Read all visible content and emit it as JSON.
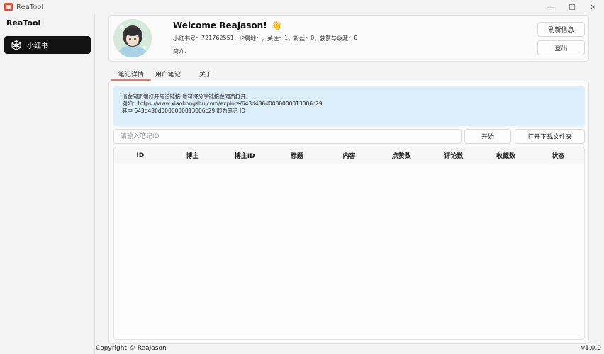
{
  "window": {
    "title": "ReaTool",
    "controls": {
      "minimize": "—",
      "maximize": "☐",
      "close": "✕"
    }
  },
  "sidebar": {
    "title": "ReaTool",
    "items": [
      {
        "label": "小红书",
        "icon": "xiaohongshu-icon",
        "active": true
      }
    ]
  },
  "profile": {
    "welcome": "Welcome ReaJason!",
    "wave": "👋",
    "id_label": "小红书号：",
    "id_value": "721762551",
    "ip_label": "，IP属地：",
    "ip_value": "",
    "follow_label": "，关注：",
    "follow_value": "1",
    "fans_label": "，粉丝：",
    "fans_value": "0",
    "likes_label": "，获赞与收藏：",
    "likes_value": "0",
    "bio_label": "简介：",
    "bio_value": "",
    "refresh_button": "刷新信息",
    "logout_button": "登出"
  },
  "tabs": [
    {
      "label": "笔记详情",
      "active": true
    },
    {
      "label": "用户笔记",
      "active": false
    },
    {
      "label": "关于",
      "active": false
    }
  ],
  "info": {
    "line1": "请在网页端打开笔记链接,也可将分享链接在网页打开。",
    "line2": "例如：https://www.xiaohongshu.com/explore/643d436d0000000013006c29",
    "line3": "其中 643d436d0000000013006c29 即为笔记 ID"
  },
  "search": {
    "placeholder": "请输入笔记ID",
    "value": "",
    "start_button": "开始",
    "open_folder_button": "打开下载文件夹"
  },
  "table": {
    "columns": [
      "ID",
      "博主",
      "博主ID",
      "标题",
      "内容",
      "点赞数",
      "评论数",
      "收藏数",
      "状态"
    ],
    "rows": []
  },
  "footer": {
    "copyright": "Copyright © ReaJason",
    "version": "v1.0.0"
  },
  "colors": {
    "accent_underline": "#e8776b",
    "nav_active_bg": "#121212",
    "info_bg": "#dbeefa"
  }
}
